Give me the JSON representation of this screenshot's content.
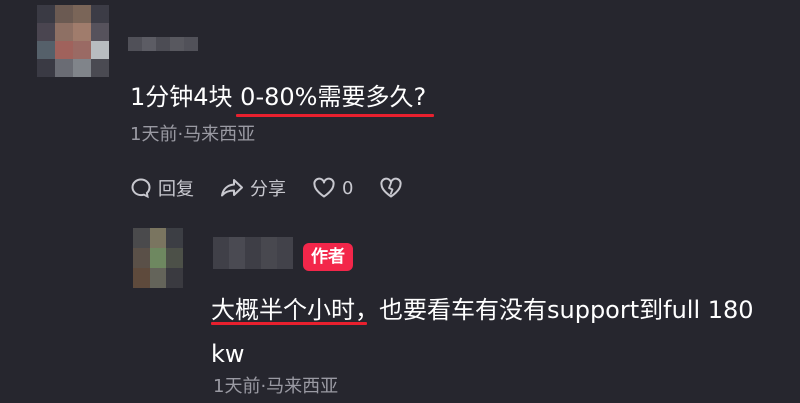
{
  "comment": {
    "text_part1": "1分钟4块 ",
    "text_part2": "0-80%需要多久?",
    "meta": "1天前·马来西亚",
    "actions": {
      "reply_label": "回复",
      "share_label": "分享",
      "like_count": "0"
    }
  },
  "reply": {
    "author_badge": "作者",
    "text": "大概半个小时，也要看车有没有support到full 180 kw",
    "meta": "1天前·马来西亚"
  },
  "colors": {
    "background": "#26262e",
    "underline": "#e8202e",
    "badge": "#f3264a",
    "meta_text": "#9a9aa3"
  }
}
